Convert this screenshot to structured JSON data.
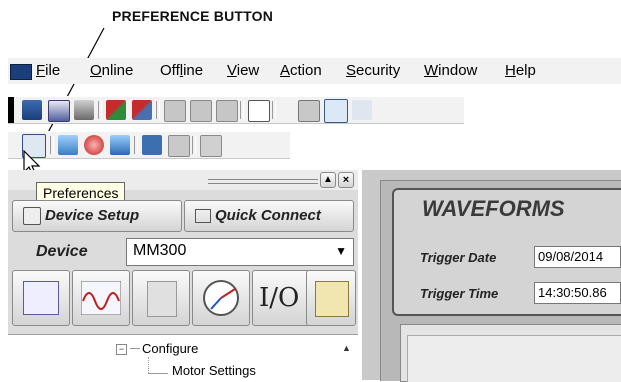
{
  "callout": {
    "text": "PREFERENCE BUTTON"
  },
  "menubar": {
    "items": [
      {
        "pre": "",
        "u": "F",
        "post": "ile"
      },
      {
        "pre": "",
        "u": "O",
        "post": "nline"
      },
      {
        "pre": "Off",
        "u": "l",
        "post": "ine"
      },
      {
        "pre": "",
        "u": "V",
        "post": "iew"
      },
      {
        "pre": "",
        "u": "A",
        "post": "ction"
      },
      {
        "pre": "",
        "u": "S",
        "post": "ecurity"
      },
      {
        "pre": "",
        "u": "W",
        "post": "indow"
      },
      {
        "pre": "",
        "u": "H",
        "post": "elp"
      }
    ]
  },
  "tooltip": {
    "text": "Preferences"
  },
  "left_panel": {
    "device_setup_label": "Device Setup",
    "quick_connect_label": "Quick Connect",
    "device_label": "Device",
    "device_value": "MM300",
    "io_label": "I/O"
  },
  "tree": {
    "configure": "Configure",
    "motor_settings": "Motor Settings"
  },
  "waveforms": {
    "title": "WAVEFORMS",
    "trigger_date_label": "Trigger Date",
    "trigger_date_value": "09/08/2014",
    "trigger_time_label": "Trigger Time",
    "trigger_time_value": "14:30:50.86"
  }
}
